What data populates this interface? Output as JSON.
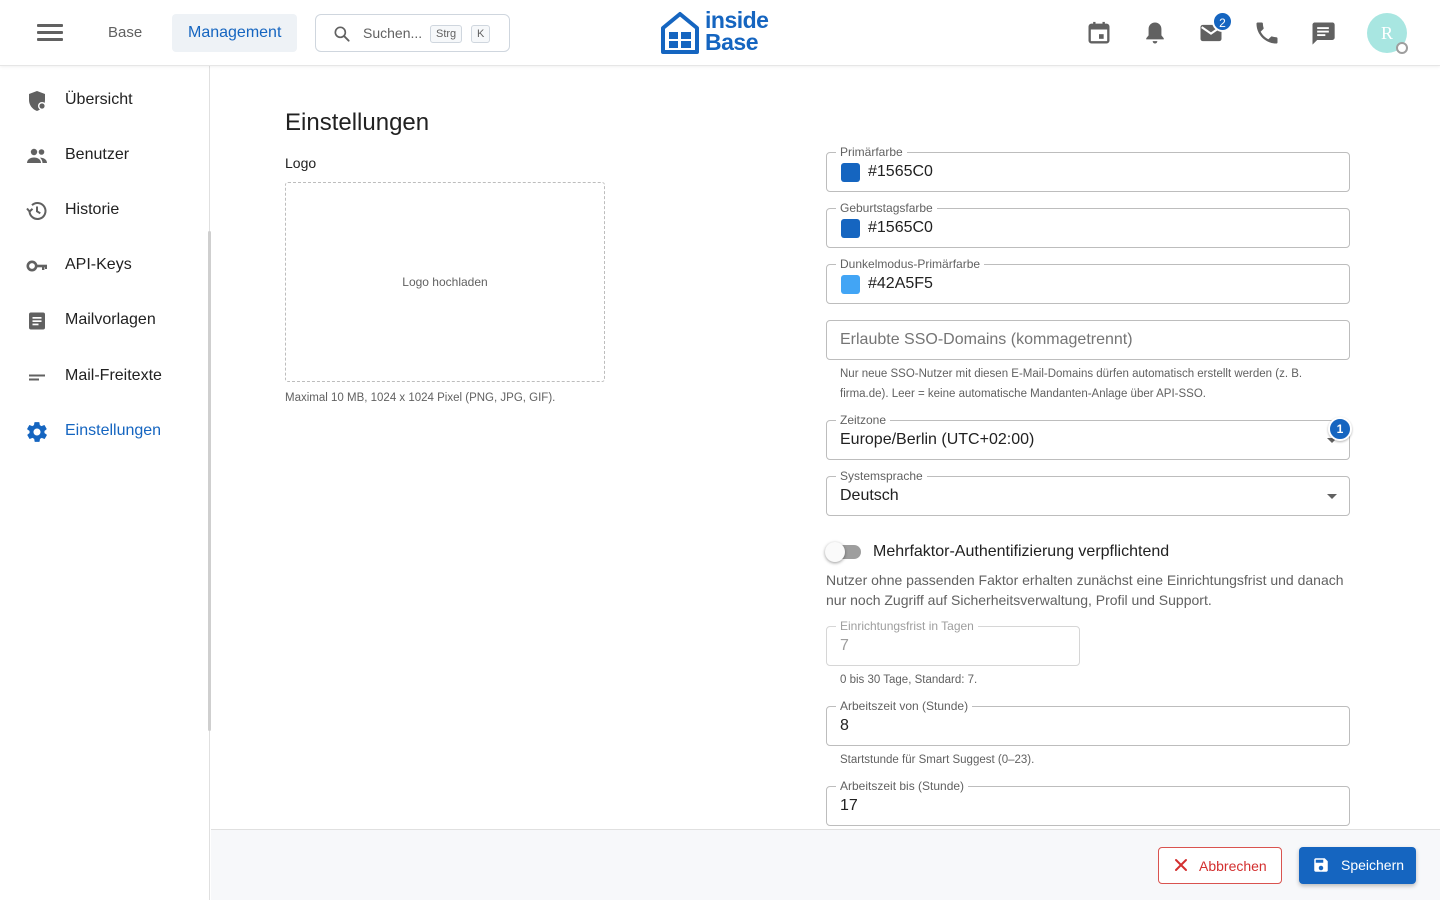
{
  "header": {
    "tabs": [
      {
        "label": "Base"
      },
      {
        "label": "Management"
      }
    ],
    "search": {
      "placeholder": "Suchen...",
      "shortcut_key1": "Strg",
      "shortcut_key2": "K"
    },
    "logo": {
      "line1": "inside",
      "line2": "Base"
    },
    "icons": [
      "calendar-icon",
      "bell-icon",
      "mail-icon",
      "phone-icon",
      "chat-icon"
    ],
    "mail_badge": "2",
    "avatar_initial": "R"
  },
  "sidebar": {
    "items": [
      {
        "label": "Übersicht",
        "icon": "shield-icon"
      },
      {
        "label": "Benutzer",
        "icon": "users-icon"
      },
      {
        "label": "Historie",
        "icon": "history-icon"
      },
      {
        "label": "API-Keys",
        "icon": "key-icon"
      },
      {
        "label": "Mailvorlagen",
        "icon": "document-icon"
      },
      {
        "label": "Mail-Freitexte",
        "icon": "text-icon"
      },
      {
        "label": "Einstellungen",
        "icon": "gear-icon",
        "active": true
      }
    ]
  },
  "main": {
    "title": "Einstellungen",
    "logo_label": "Logo",
    "upload_text": "Logo hochladen",
    "upload_hint": "Maximal 10 MB, 1024 x 1024 Pixel (PNG, JPG, GIF).",
    "fields": {
      "primary": {
        "label": "Primärfarbe",
        "value": "#1565C0",
        "swatch": "#1565c0"
      },
      "birthday": {
        "label": "Geburtstagsfarbe",
        "value": "#1565C0",
        "swatch": "#1565c0"
      },
      "dark_primary": {
        "label": "Dunkelmodus-Primärfarbe",
        "value": "#42A5F5",
        "swatch": "#42a5f5"
      },
      "sso": {
        "placeholder": "Erlaubte SSO-Domains (kommagetrennt)",
        "helper_line1": "Nur neue SSO-Nutzer mit diesen E-Mail-Domains dürfen automatisch erstellt werden (z. B.",
        "helper_line2": "firma.de). Leer = keine automatische Mandanten-Anlage über API-SSO."
      },
      "timezone": {
        "label": "Zeitzone",
        "value": "Europe/Berlin (UTC+02:00)",
        "badge": "1"
      },
      "language": {
        "label": "Systemsprache",
        "value": "Deutsch"
      },
      "mfa": {
        "label": "Mehrfaktor-Authentifizierung verpflichtend",
        "enabled": false,
        "desc": "Nutzer ohne passenden Faktor erhalten zunächst eine Einrichtungsfrist und danach nur noch Zugriff auf Sicherheitsverwaltung, Profil und Support."
      },
      "grace_period": {
        "label": "Einrichtungsfrist in Tagen",
        "value": "7",
        "helper": "0 bis 30 Tage, Standard: 7."
      },
      "work_from": {
        "label": "Arbeitszeit von (Stunde)",
        "value": "8",
        "helper": "Startstunde für Smart Suggest (0–23)."
      },
      "work_to": {
        "label": "Arbeitszeit bis (Stunde)",
        "value": "17"
      }
    }
  },
  "footer": {
    "cancel_label": "Abbrechen",
    "save_label": "Speichern"
  },
  "colors": {
    "accent": "#1565c0",
    "danger": "#d32f2f"
  }
}
